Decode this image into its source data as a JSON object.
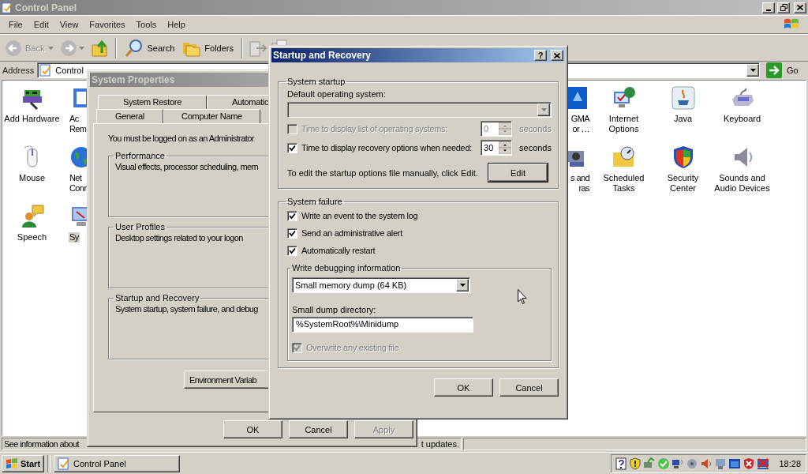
{
  "explorer": {
    "title": "Control Panel",
    "menus": [
      "File",
      "Edit",
      "View",
      "Favorites",
      "Tools",
      "Help"
    ],
    "toolbar": {
      "back": {
        "label": "Back",
        "disabled": true
      },
      "search": "Search",
      "folders": "Folders"
    },
    "address": {
      "label": "Address",
      "value": "Control",
      "go": "Go"
    },
    "items": [
      {
        "lines": [
          "Add Hardware"
        ],
        "selected": false
      },
      {
        "lines": [
          "Ac",
          "Rem"
        ],
        "selected": false
      },
      {
        "lines": [
          "GMA",
          "or …"
        ],
        "selected": false
      },
      {
        "lines": [
          "Internet",
          "Options"
        ],
        "selected": false
      },
      {
        "lines": [
          "Java"
        ],
        "selected": false
      },
      {
        "lines": [
          "Keyboard"
        ],
        "selected": false
      },
      {
        "lines": [
          "Mouse"
        ],
        "selected": false
      },
      {
        "lines": [
          "Net",
          "Conn"
        ],
        "selected": false
      },
      {
        "lines": [
          "s and",
          "ras"
        ],
        "selected": false
      },
      {
        "lines": [
          "Scheduled",
          "Tasks"
        ],
        "selected": false
      },
      {
        "lines": [
          "Security",
          "Center"
        ],
        "selected": false
      },
      {
        "lines": [
          "Sounds and",
          "Audio Devices"
        ],
        "selected": false
      },
      {
        "lines": [
          "Speech"
        ],
        "selected": false
      },
      {
        "lines": [
          "Sy"
        ],
        "selected": true
      }
    ],
    "status": [
      "See information about",
      "t updates."
    ]
  },
  "system_properties": {
    "title": "System Properties",
    "tabs_back": [
      {
        "label": "System Restore",
        "selected": false
      },
      {
        "label": "Automatic",
        "selected": false
      }
    ],
    "tabs_front": [
      {
        "label": "General",
        "selected": false
      },
      {
        "label": "Computer Name",
        "selected": false
      }
    ],
    "notice": "You must be logged on as an Administrator",
    "groups": [
      {
        "title": "Performance",
        "text": "Visual effects, processor scheduling, mem"
      },
      {
        "title": "User Profiles",
        "text": "Desktop settings related to your logon"
      },
      {
        "title": "Startup and Recovery",
        "text": "System startup, system failure, and debug"
      }
    ],
    "env_button": "Environment Variab",
    "buttons": [
      {
        "label": "OK",
        "disabled": false
      },
      {
        "label": "Cancel",
        "disabled": false
      },
      {
        "label": "Apply",
        "disabled": true
      }
    ]
  },
  "startup_recovery": {
    "title": "Startup and Recovery",
    "help": "?",
    "startup": {
      "title": "System startup",
      "os_label": "Default operating system:",
      "os_disabled": true,
      "timers": [
        {
          "label": "Time to display list of operating systems:",
          "checked": false,
          "disabled": true,
          "value": "0",
          "unit": "seconds"
        },
        {
          "label": "Time to display recovery options when needed:",
          "checked": true,
          "disabled": false,
          "value": "30",
          "unit": "seconds"
        }
      ],
      "edit_text": "To edit the startup options file manually, click Edit.",
      "edit_button": "Edit"
    },
    "failure": {
      "title": "System failure",
      "checks": [
        {
          "label": "Write an event to the system log",
          "checked": true,
          "disabled": false
        },
        {
          "label": "Send an administrative alert",
          "checked": true,
          "disabled": false
        },
        {
          "label": "Automatically restart",
          "checked": true,
          "disabled": false
        }
      ],
      "debug": {
        "title": "Write debugging information",
        "dump_type": "Small memory dump (64 KB)",
        "dir_label": "Small dump directory:",
        "dir_value": "%SystemRoot%\\Minidump",
        "overwrite": {
          "label": "Overwrite any existing file",
          "checked": true,
          "disabled": true
        }
      }
    },
    "buttons": [
      {
        "label": "OK",
        "disabled": false
      },
      {
        "label": "Cancel",
        "disabled": false
      }
    ]
  },
  "taskbar": {
    "start": "Start",
    "tasks": [
      {
        "label": "Control Panel",
        "selected": false
      }
    ],
    "clock": "18:28"
  }
}
